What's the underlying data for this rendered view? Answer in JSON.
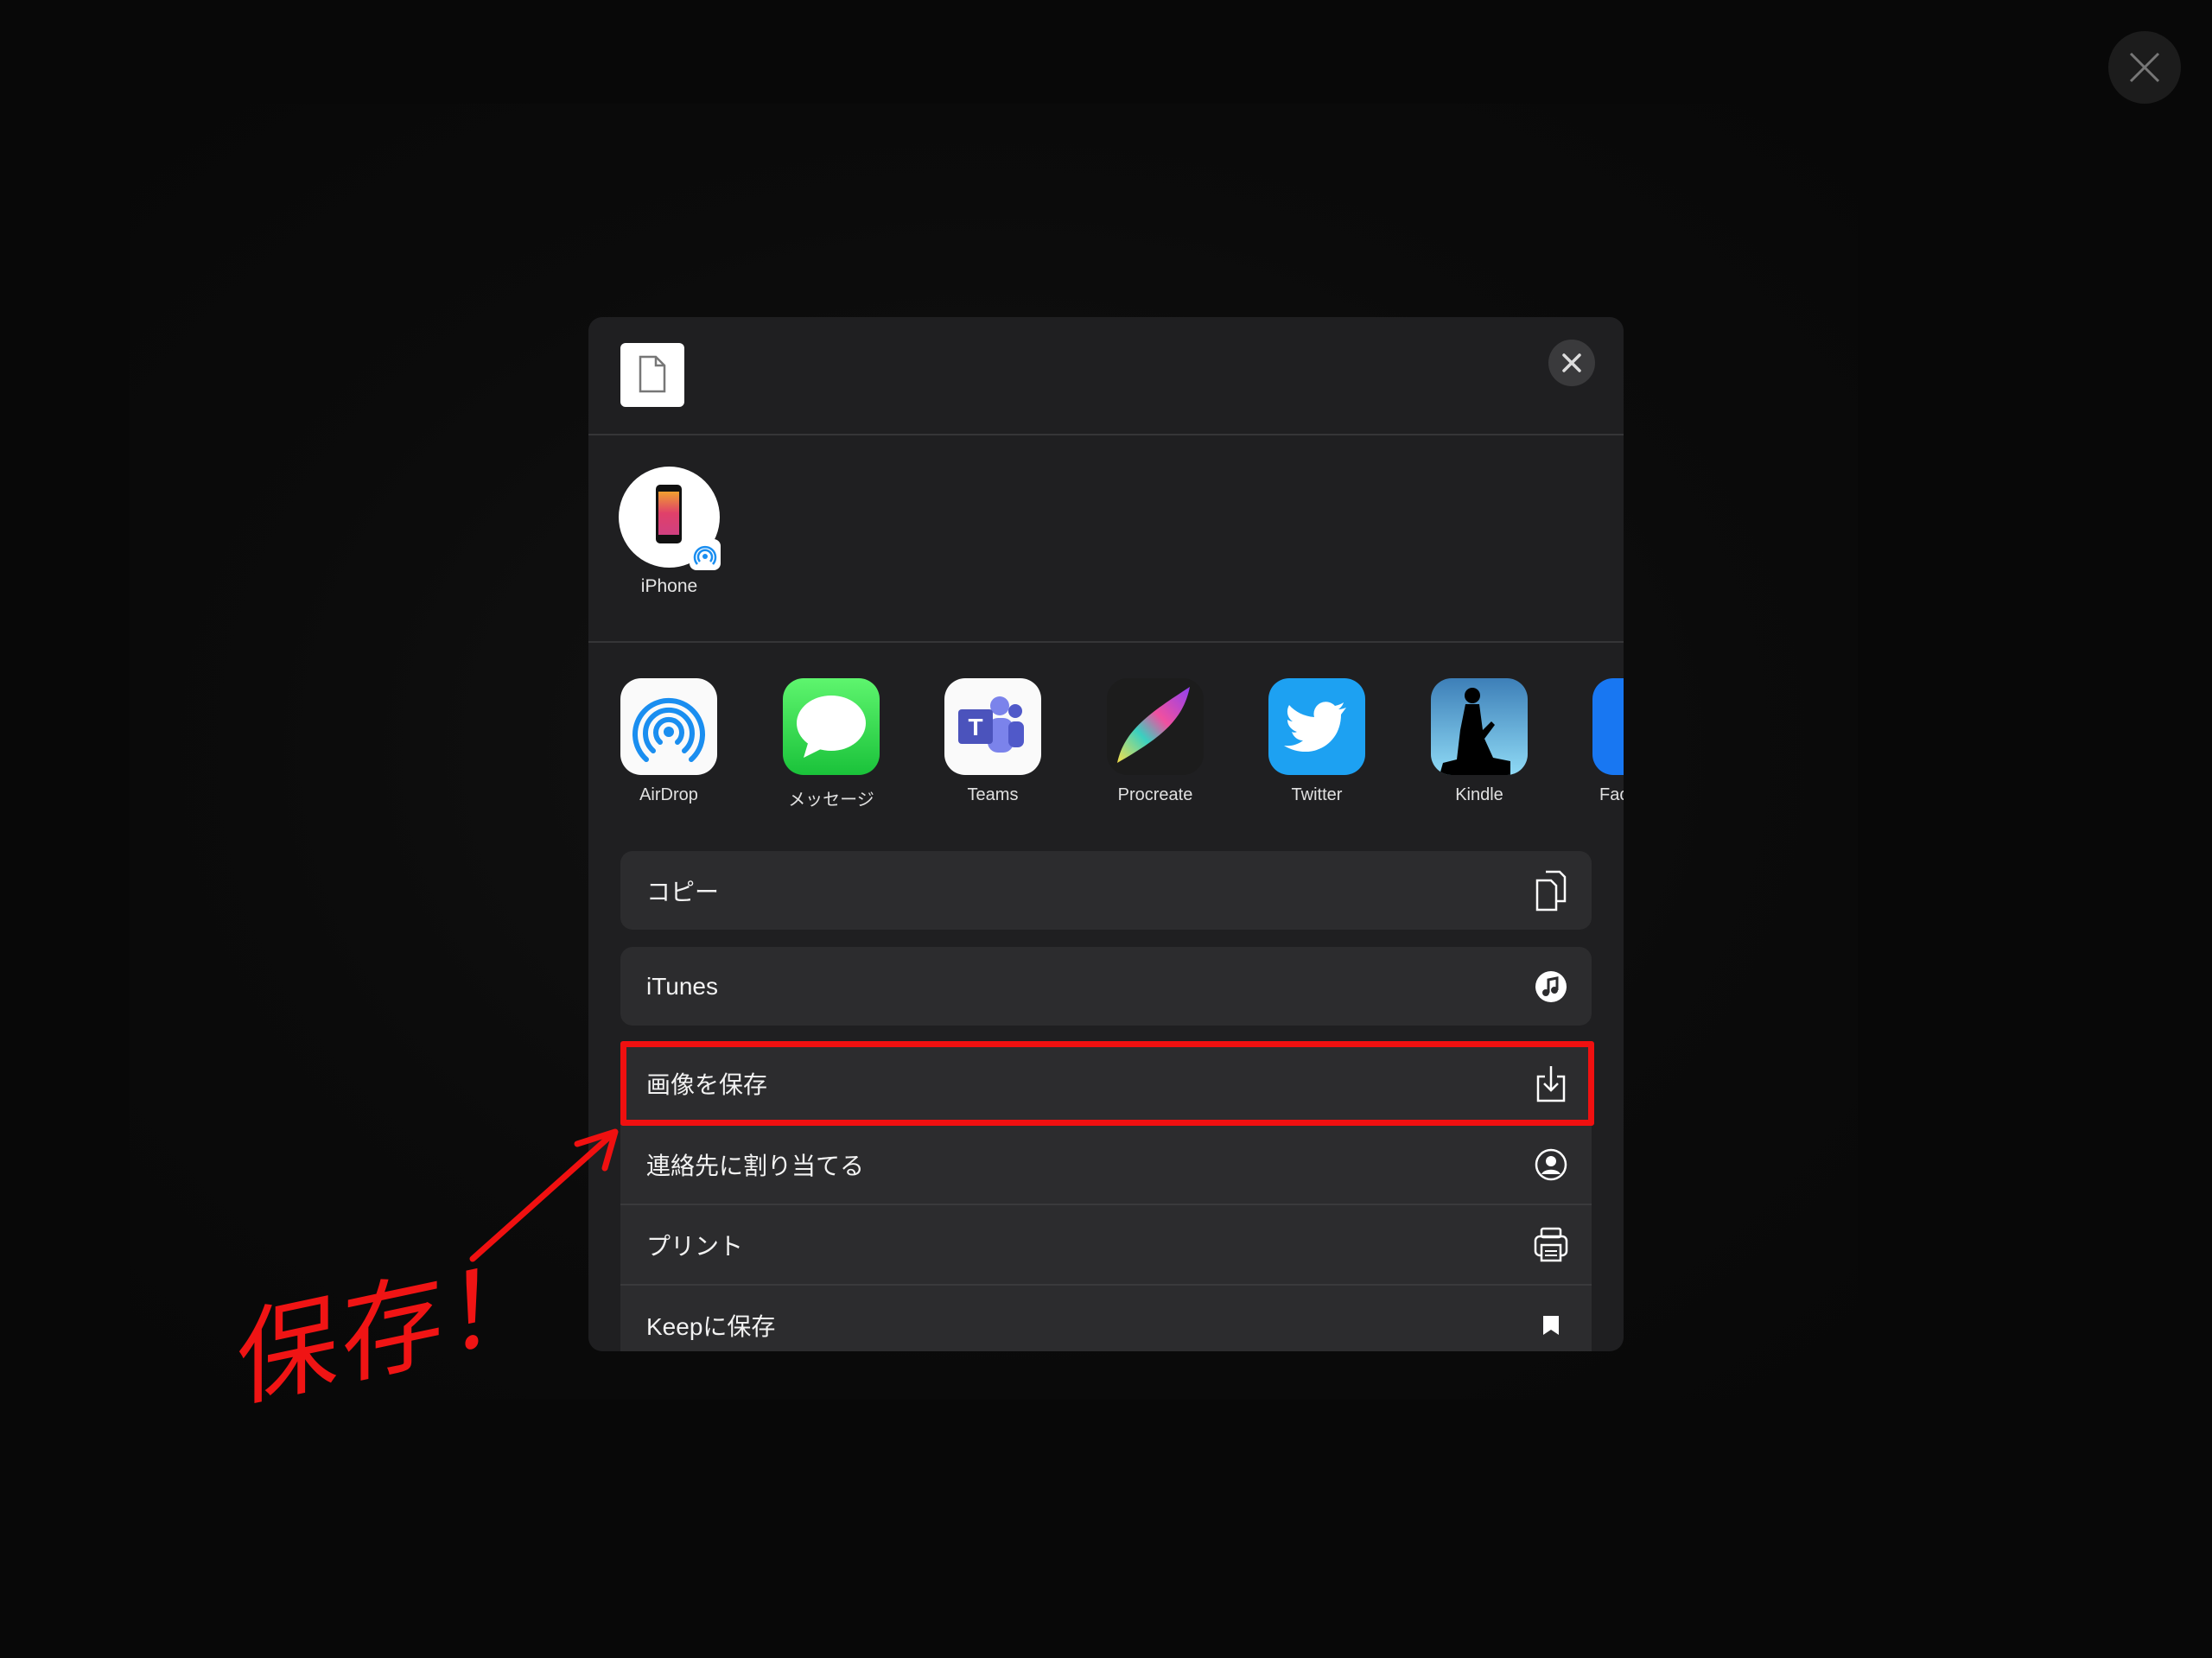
{
  "share_sheet": {
    "people": [
      {
        "label": "iPhone",
        "icon": "iphone-airdrop-icon"
      }
    ],
    "apps": [
      {
        "label": "AirDrop",
        "icon": "airdrop-icon",
        "color": "#ffffff"
      },
      {
        "label": "メッセージ",
        "icon": "messages-icon",
        "color": "#2fcf4e"
      },
      {
        "label": "Teams",
        "icon": "teams-icon",
        "color": "#ffffff"
      },
      {
        "label": "Procreate",
        "icon": "procreate-icon",
        "color": "#1a1a1a"
      },
      {
        "label": "Twitter",
        "icon": "twitter-icon",
        "color": "#1da1f2"
      },
      {
        "label": "Kindle",
        "icon": "kindle-icon",
        "color": "#6ab8e0"
      },
      {
        "label": "Fac",
        "icon": "facebook-icon",
        "color": "#1877f2"
      }
    ],
    "actions": [
      {
        "label": "コピー",
        "icon": "copy-icon"
      },
      {
        "label": "iTunes",
        "icon": "music-note-icon"
      },
      {
        "label": "画像を保存",
        "icon": "save-download-icon"
      },
      {
        "label": "連絡先に割り当てる",
        "icon": "contact-icon"
      },
      {
        "label": "プリント",
        "icon": "printer-icon"
      },
      {
        "label": "Keepに保存",
        "icon": "bookmark-icon"
      }
    ]
  },
  "annotation": {
    "text": "保存！",
    "color": "#f01010"
  }
}
